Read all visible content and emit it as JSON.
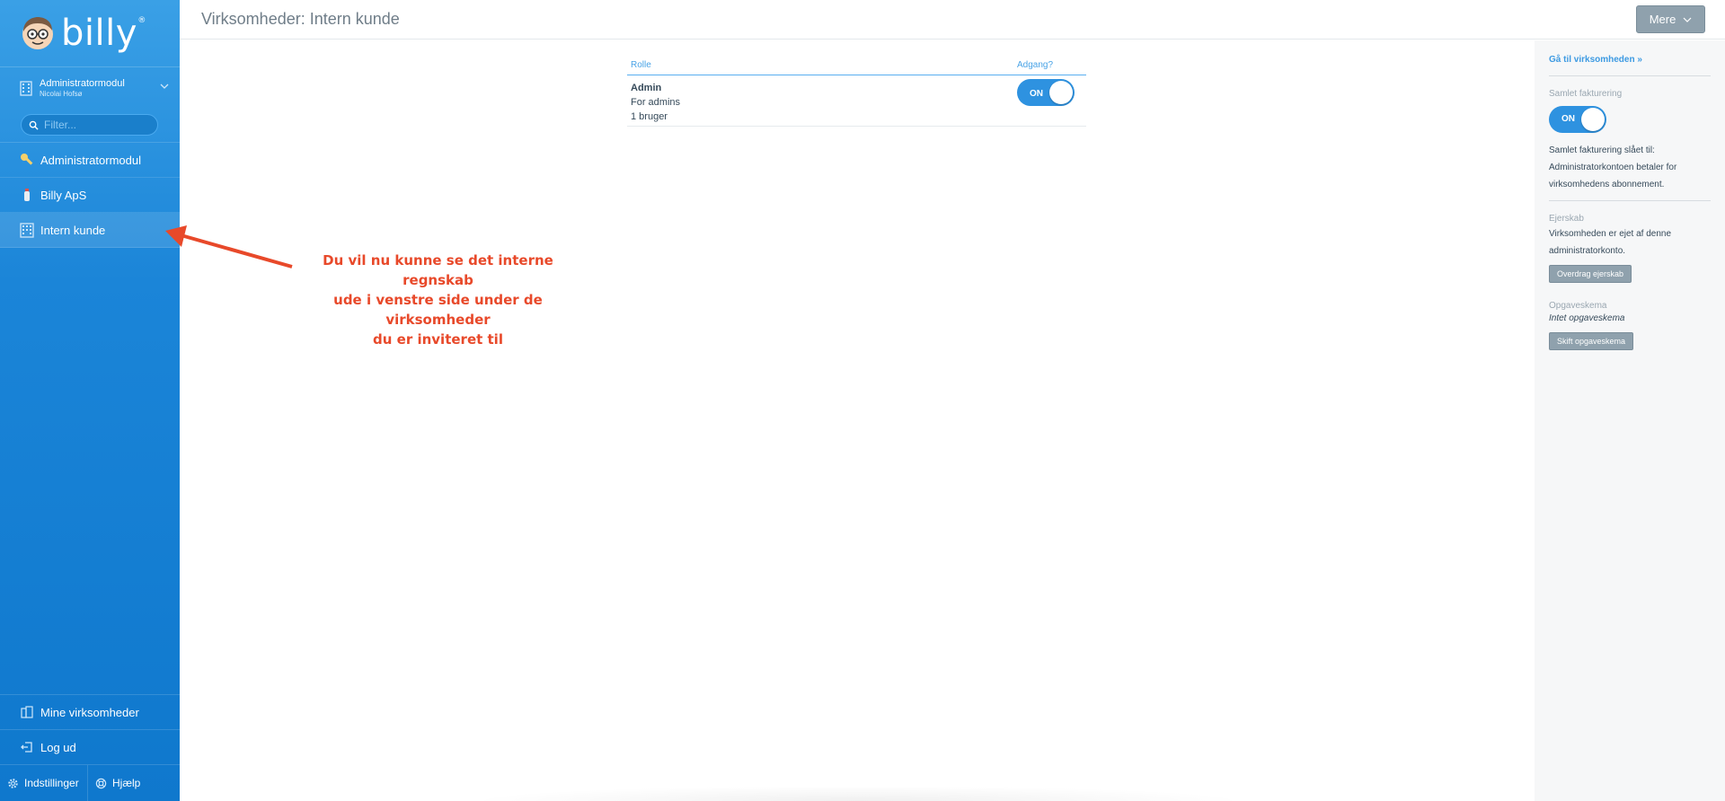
{
  "brand": {
    "name": "billy",
    "trademark": "®"
  },
  "org_switcher": {
    "title": "Administratormodul",
    "subtitle": "Nicolai Hofsø"
  },
  "filter": {
    "placeholder": "Filter..."
  },
  "sidebar": {
    "items": [
      {
        "label": "Administratormodul",
        "icon": "key-icon"
      },
      {
        "label": "Billy ApS",
        "icon": "bottle-icon"
      },
      {
        "label": "Intern kunde",
        "icon": "building-icon"
      }
    ],
    "bottom": {
      "my_companies": "Mine virksomheder",
      "logout": "Log ud",
      "settings": "Indstillinger",
      "help": "Hjælp"
    }
  },
  "header": {
    "title": "Virksomheder: Intern kunde",
    "more_label": "Mere"
  },
  "roles_table": {
    "col_role": "Rolle",
    "col_access": "Adgang?",
    "rows": [
      {
        "name": "Admin",
        "description": "For admins",
        "users": "1 bruger",
        "access": "ON"
      }
    ]
  },
  "right_panel": {
    "goto_link": "Gå til virksomheden »",
    "billing_label": "Samlet fakturering",
    "billing_toggle": "ON",
    "billing_text_1": "Samlet fakturering slået til:",
    "billing_text_2": "Administratorkontoen betaler for",
    "billing_text_3": "virksomhedens abonnement.",
    "ownership_label": "Ejerskab",
    "ownership_text_1": "Virksomheden er ejet af denne",
    "ownership_text_2": "administratorkonto.",
    "ownership_button": "Overdrag ejerskab",
    "tasks_label": "Opgaveskema",
    "tasks_value": "Intet opgaveskema",
    "tasks_button": "Skift opgaveskema"
  },
  "annotation": {
    "line1": "Du vil nu kunne se det interne regnskab",
    "line2": "ude i venstre side under de virksomheder",
    "line3": "du er inviteret til",
    "color": "#e8492a"
  },
  "colors": {
    "sidebar": "#1b85d8",
    "accent": "#2e92e0",
    "button_gray": "#8fa1ad"
  }
}
